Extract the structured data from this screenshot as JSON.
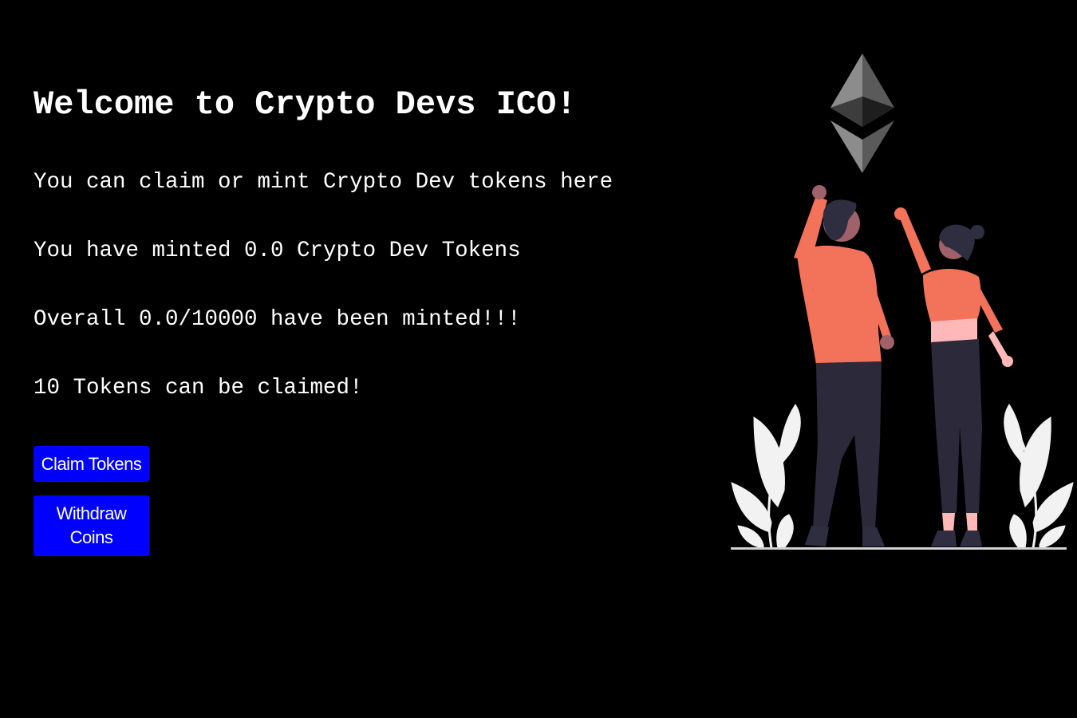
{
  "heading": "Welcome to Crypto Devs ICO!",
  "description": "You can claim or mint Crypto Dev tokens here",
  "minted_text": "You have minted 0.0 Crypto Dev Tokens",
  "overall_text": "Overall 0.0/10000 have been minted!!!",
  "claimable_text": "10 Tokens can be claimed!",
  "buttons": {
    "claim_label": "Claim Tokens",
    "withdraw_label": "Withdraw Coins"
  },
  "colors": {
    "background": "#000000",
    "text": "#ffffff",
    "button": "#0000ff",
    "shirt": "#f2725a",
    "pants": "#2c2a3a",
    "skin": "#a0616a",
    "leaf": "#f2f2f2"
  },
  "illustration": {
    "icons": [
      "ethereum-logo-icon",
      "people-celebrating-illustration",
      "plant-icon"
    ]
  }
}
